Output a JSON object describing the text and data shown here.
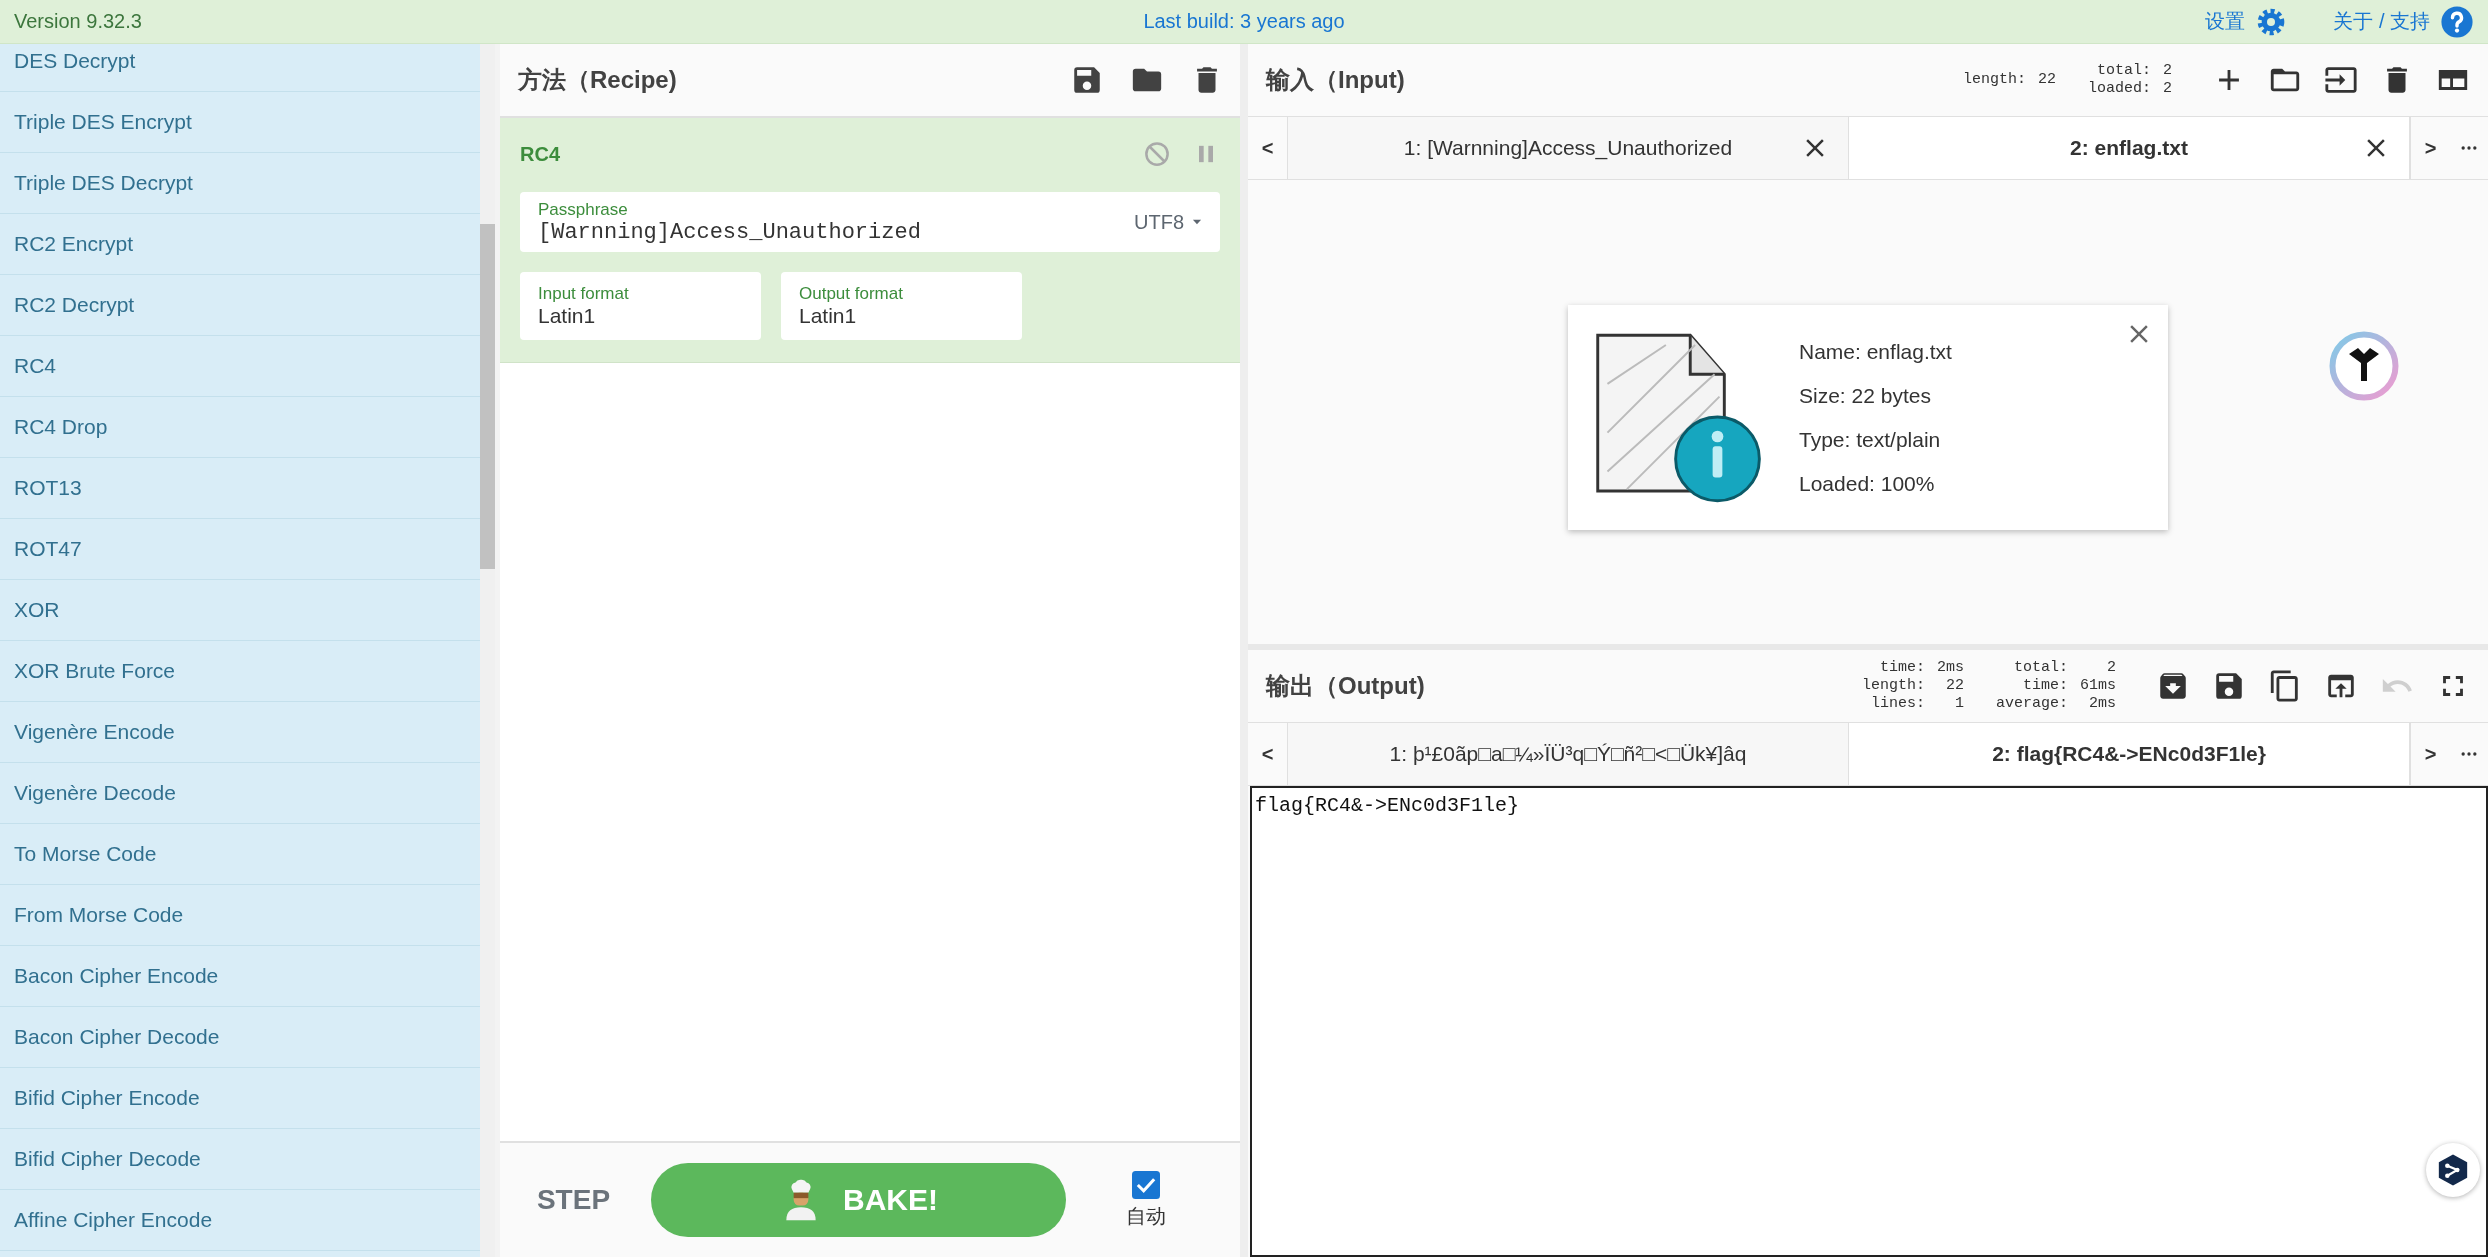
{
  "top_bar": {
    "version": "Version 9.32.3",
    "last_build": "Last build: 3 years ago",
    "settings": "设置",
    "about": "关于 / 支持"
  },
  "operations": [
    "DES Decrypt",
    "Triple DES Encrypt",
    "Triple DES Decrypt",
    "RC2 Encrypt",
    "RC2 Decrypt",
    "RC4",
    "RC4 Drop",
    "ROT13",
    "ROT47",
    "XOR",
    "XOR Brute Force",
    "Vigenère Encode",
    "Vigenère Decode",
    "To Morse Code",
    "From Morse Code",
    "Bacon Cipher Encode",
    "Bacon Cipher Decode",
    "Bifid Cipher Encode",
    "Bifid Cipher Decode",
    "Affine Cipher Encode"
  ],
  "recipe": {
    "title": "方法（Recipe)",
    "operation": {
      "name": "RC4",
      "args": [
        {
          "kind": "toggle-text",
          "label": "Passphrase",
          "value": "[Warnning]Access_Unauthorized",
          "option": "UTF8"
        },
        {
          "kind": "select",
          "label": "Input format",
          "value": "Latin1"
        },
        {
          "kind": "select",
          "label": "Output format",
          "value": "Latin1"
        }
      ]
    },
    "step": "STEP",
    "bake": "BAKE!",
    "auto_bake": {
      "label": "自动",
      "checked": true
    }
  },
  "input": {
    "title": "输入（Input)",
    "stat_columns": [
      [
        {
          "label": "length:",
          "value": "22"
        }
      ],
      [
        {
          "label": "total:",
          "value": "2"
        },
        {
          "label": "loaded:",
          "value": "2"
        }
      ]
    ],
    "prev": "<",
    "next": ">",
    "tabs": [
      {
        "label": "1: [Warnning]Access_Unauthorized",
        "selected": false
      },
      {
        "label": "2: enflag.txt",
        "selected": true
      }
    ],
    "file": {
      "name": "Name: enflag.txt",
      "size": "Size: 22 bytes",
      "type": "Type: text/plain",
      "loaded": "Loaded: 100%"
    }
  },
  "output": {
    "title": "输出（Output)",
    "stat_columns": [
      [
        {
          "label": "time:",
          "value": "2ms"
        },
        {
          "label": "length:",
          "value": "22"
        },
        {
          "label": "lines:",
          "value": "1"
        }
      ],
      [
        {
          "label": "total:",
          "value": "2"
        },
        {
          "label": "time:",
          "value": "61ms"
        },
        {
          "label": "average:",
          "value": "2ms"
        }
      ]
    ],
    "prev": "<",
    "next": ">",
    "tabs": [
      {
        "label": "1: þ¹£0ãp□a□¼»ÏÜ³q□Ý□ñ²□<□Ük¥]âq",
        "selected": false
      },
      {
        "label": "2: flag{RC4&->ENc0d3F1le}",
        "selected": true
      }
    ],
    "text": "flag{RC4&->ENc0d3F1le}"
  }
}
